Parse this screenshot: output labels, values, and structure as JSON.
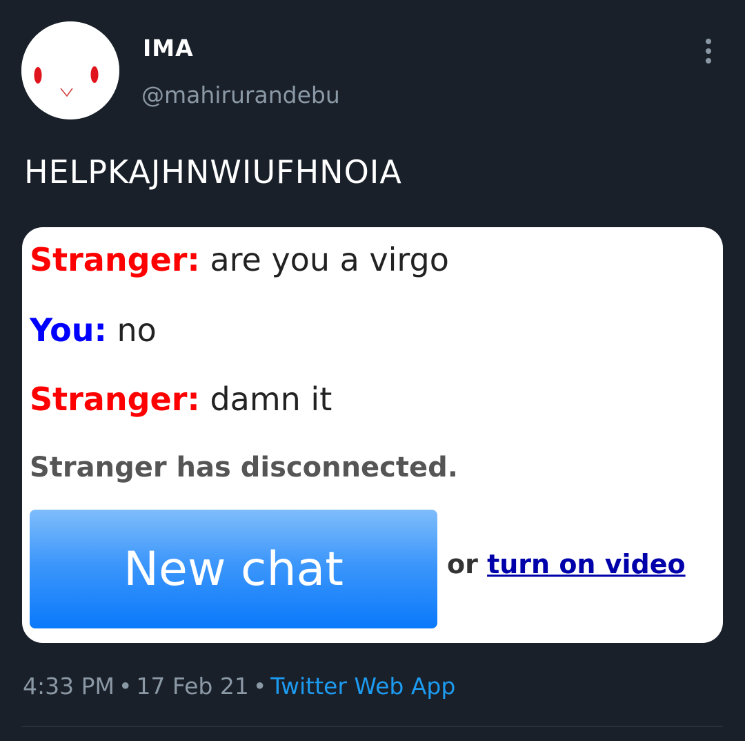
{
  "tweet": {
    "author": {
      "display_name": "IMA",
      "handle": "@mahirurandebu",
      "avatar_icon": "face-doodle-avatar"
    },
    "more_icon": "vertical-ellipsis-icon",
    "text": "HELPKAJHNWIUFHNOIA",
    "timestamp": "4:33 PM",
    "separator": "•",
    "date": "17 Feb 21",
    "source": "Twitter Web App"
  },
  "embedded_chat": {
    "messages": [
      {
        "speaker": "Stranger:",
        "text": "are you a virgo",
        "speaker_color": "#ff0000"
      },
      {
        "speaker": "You:",
        "text": "no",
        "speaker_color": "#0000ff"
      },
      {
        "speaker": "Stranger:",
        "text": "damn it",
        "speaker_color": "#ff0000"
      }
    ],
    "status": "Stranger has disconnected.",
    "new_chat_label": "New chat",
    "or_text": "or",
    "video_link_label": "turn on video"
  },
  "colors": {
    "background": "#19202a",
    "secondary_text": "#8b98a5",
    "link_blue": "#1d9bf0",
    "button_blue": "#0a79fb"
  }
}
